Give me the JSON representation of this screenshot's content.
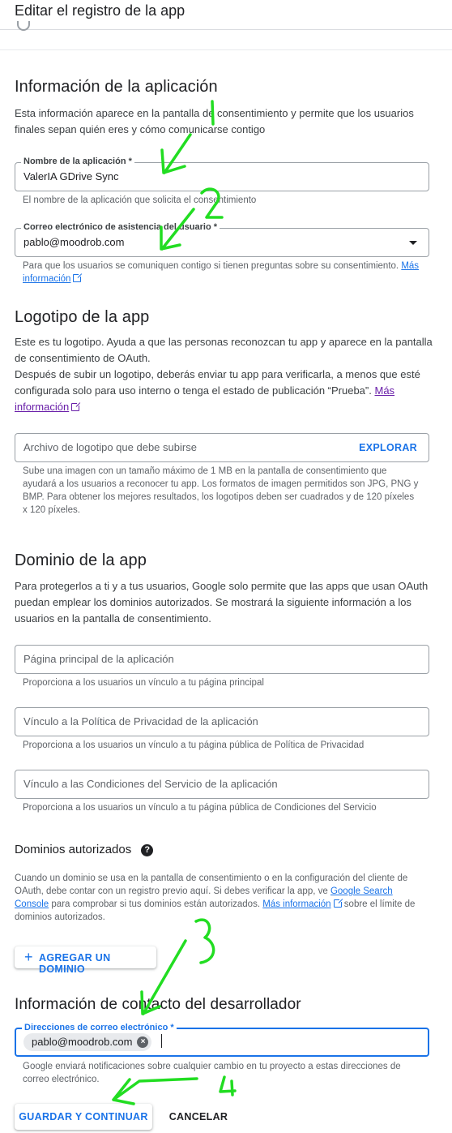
{
  "header": {
    "title": "Editar el registro de la app"
  },
  "app_info": {
    "heading": "Información de la aplicación",
    "description": "Esta información aparece en la pantalla de consentimiento y permite que los usuarios finales sepan quién eres y cómo comunicarse contigo",
    "app_name": {
      "label": "Nombre de la aplicación *",
      "value": "ValerIA GDrive Sync",
      "hint": "El nombre de la aplicación que solicita el consentimiento"
    },
    "support_email": {
      "label": "Correo electrónico de asistencia del usuario *",
      "value": "pablo@moodrob.com",
      "hint": "Para que los usuarios se comuniquen contigo si tienen preguntas sobre su consentimiento.",
      "link": "Más información"
    }
  },
  "logo": {
    "heading": "Logotipo de la app",
    "description_1": "Este es tu logotipo. Ayuda a que las personas reconozcan tu app y aparece en la pantalla de consentimiento de OAuth.",
    "description_2": "Después de subir un logotipo, deberás enviar tu app para verificarla, a menos que esté configurada solo para uso interno o tenga el estado de publicación “Prueba”.",
    "link": "Más información",
    "file_placeholder": "Archivo de logotipo que debe subirse",
    "browse_button": "EXPLORAR",
    "hint": "Sube una imagen con un tamaño máximo de 1 MB en la pantalla de consentimiento que ayudará a los usuarios a reconocer tu app. Los formatos de imagen permitidos son JPG, PNG y BMP. Para obtener los mejores resultados, los logotipos deben ser cuadrados y de 120 píxeles x 120 píxeles."
  },
  "domain": {
    "heading": "Dominio de la app",
    "description": "Para protegerlos a ti y a tus usuarios, Google solo permite que las apps que usan OAuth puedan emplear los dominios autorizados. Se mostrará la siguiente información a los usuarios en la pantalla de consentimiento.",
    "homepage": {
      "placeholder": "Página principal de la aplicación",
      "hint": "Proporciona a los usuarios un vínculo a tu página principal"
    },
    "privacy": {
      "placeholder": "Vínculo a la Política de Privacidad de la aplicación",
      "hint": "Proporciona a los usuarios un vínculo a tu página pública de Política de Privacidad"
    },
    "terms": {
      "placeholder": "Vínculo a las Condiciones del Servicio de la aplicación",
      "hint": "Proporciona a los usuarios un vínculo a tu página pública de Condiciones del Servicio"
    }
  },
  "authorized_domains": {
    "heading": "Dominios autorizados",
    "help_icon": "help-circle-icon",
    "text_1": "Cuando un dominio se usa en la pantalla de consentimiento o en la configuración del cliente de OAuth, debe contar con un registro previo aquí. Si debes verificar la app, ve",
    "search_console_link": "Google Search Console",
    "text_2": "para comprobar si tus dominios están autorizados.",
    "more_link": "Más información",
    "text_3": "sobre el límite de dominios autorizados.",
    "add_button": "AGREGAR UN DOMINIO"
  },
  "developer_contact": {
    "heading": "Información de contacto del desarrollador",
    "label": "Direcciones de correo electrónico *",
    "chip": "pablo@moodrob.com",
    "hint": "Google enviará notificaciones sobre cualquier cambio en tu proyecto a estas direcciones de correo electrónico."
  },
  "actions": {
    "save": "GUARDAR Y CONTINUAR",
    "cancel": "CANCELAR"
  },
  "annotations": {
    "color": "#22dd22",
    "labels": [
      "1",
      "2",
      "3",
      "4"
    ]
  }
}
